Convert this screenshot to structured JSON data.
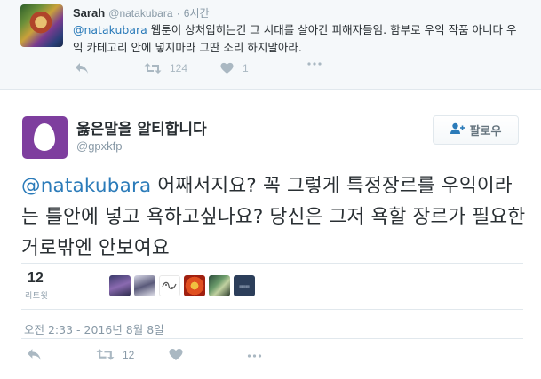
{
  "parent_tweet": {
    "name": "Sarah",
    "handle": "@natakubara",
    "separator": "·",
    "time": "6시간",
    "mention": "@natakubara",
    "text": " 웹툰이 상처입히는건 그 시대를 살아간 피해자들임. 함부로 우익 작품 아니다 우익 카테고리 안에 넣지마라 그딴 소리 하지말아라.",
    "retweet_count": "124",
    "like_count": "1"
  },
  "main_tweet": {
    "name": "옳은말을 알티합니다",
    "handle": "@gpxkfp",
    "follow_label": "팔로우",
    "mention": "@natakubara",
    "text": " 어째서지요? 꼭 그렇게 특정장르를 우익이라는 틀안에 넣고 욕하고싶나요? 당신은 그저 욕할 장르가 필요한거로밖엔 안보여요",
    "retweet_count": "12",
    "retweet_label": "리트윗",
    "date": "오전 2:33 - 2016년 8월 8일",
    "action_retweet_count": "12"
  },
  "icons": {
    "reply": "reply-icon",
    "retweet": "retweet-icon",
    "like": "heart-icon",
    "more": "more-icon",
    "follow": "follow-user-icon"
  },
  "colors": {
    "link": "#2b7bb9",
    "muted": "#8899a6",
    "action_icon": "#aab8c2",
    "avatar_purple": "#7e3e9e"
  }
}
